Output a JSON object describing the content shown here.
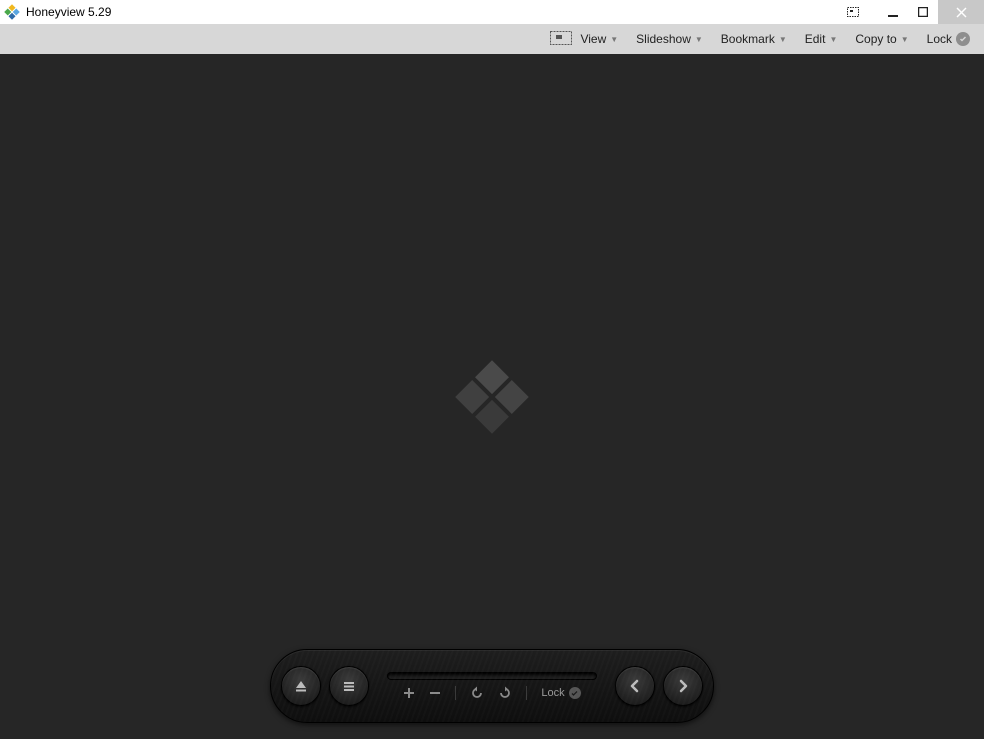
{
  "titlebar": {
    "title": "Honeyview 5.29"
  },
  "toolbar": {
    "view": "View",
    "slideshow": "Slideshow",
    "bookmark": "Bookmark",
    "edit": "Edit",
    "copyto": "Copy to",
    "lock": "Lock"
  },
  "controlbar": {
    "lock": "Lock"
  }
}
